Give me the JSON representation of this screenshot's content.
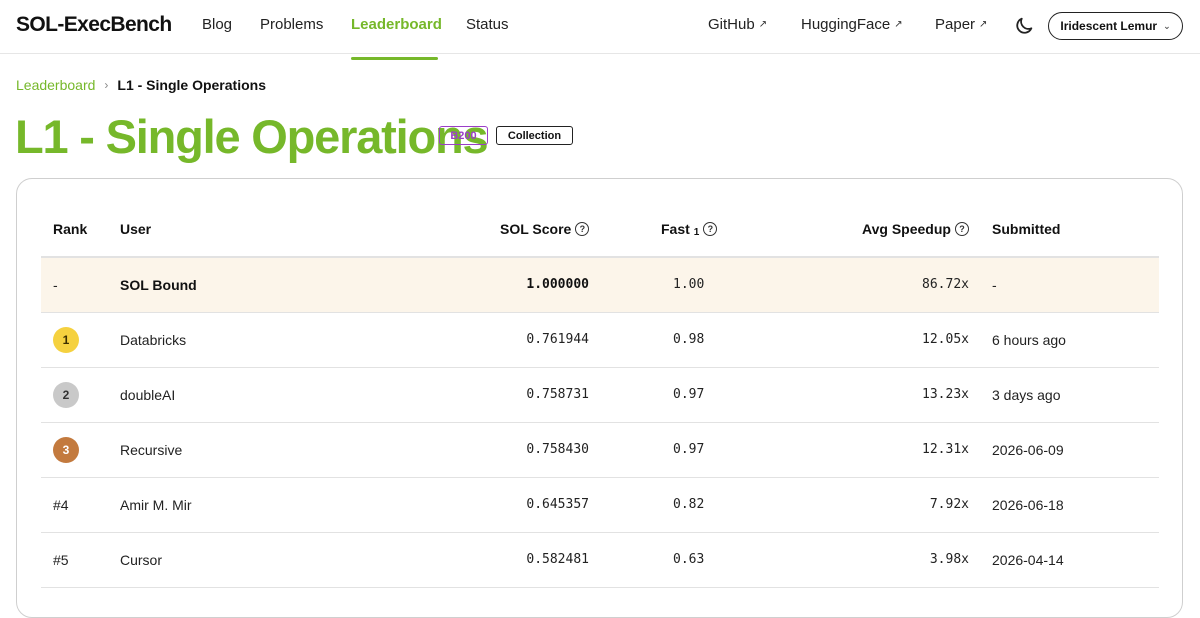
{
  "header": {
    "logo": "SOL-ExecBench",
    "nav": [
      {
        "label": "Blog"
      },
      {
        "label": "Problems"
      },
      {
        "label": "Leaderboard",
        "active": true
      },
      {
        "label": "Status"
      }
    ],
    "external_links": [
      {
        "label": "GitHub",
        "icon": "external-arrow-icon"
      },
      {
        "label": "HuggingFace",
        "icon": "external-arrow-icon"
      },
      {
        "label": "Paper",
        "icon": "external-arrow-icon"
      }
    ],
    "theme_icon": "moon-icon",
    "user_name": "Iridescent Lemur",
    "user_chevron": "⌄"
  },
  "breadcrumb": {
    "parent": "Leaderboard",
    "separator": "›",
    "current": "L1 - Single Operations"
  },
  "page": {
    "title": "L1 - Single Operations",
    "badges": {
      "gpu": "B200",
      "collection": "Collection"
    }
  },
  "colors": {
    "accent": "#76b82a",
    "gpu_badge": "#9b3ec8",
    "sol_row_bg": "#fcf5ea",
    "gold": "#f5d13f",
    "silver": "#c9c9c9",
    "bronze": "#c37a3e"
  },
  "table": {
    "columns": {
      "rank": "Rank",
      "user": "User",
      "sol_score": "SOL Score",
      "fast": "Fast",
      "fast_sub": "1",
      "avg_speedup": "Avg Speedup",
      "submitted": "Submitted"
    },
    "help_icon": "?",
    "rows": [
      {
        "rank": "-",
        "user": "SOL Bound",
        "sol_score": "1.000000",
        "fast": "1.00",
        "avg_speedup": "86.72x",
        "submitted": "-"
      },
      {
        "rank": "1",
        "medal": "gold",
        "user": "Databricks",
        "sol_score": "0.761944",
        "fast": "0.98",
        "avg_speedup": "12.05x",
        "submitted": "6 hours ago"
      },
      {
        "rank": "2",
        "medal": "silver",
        "user": "doubleAI",
        "sol_score": "0.758731",
        "fast": "0.97",
        "avg_speedup": "13.23x",
        "submitted": "3 days ago"
      },
      {
        "rank": "3",
        "medal": "bronze",
        "user": "Recursive",
        "sol_score": "0.758430",
        "fast": "0.97",
        "avg_speedup": "12.31x",
        "submitted": "2026-06-09"
      },
      {
        "rank": "#4",
        "user": "Amir M. Mir",
        "sol_score": "0.645357",
        "fast": "0.82",
        "avg_speedup": "7.92x",
        "submitted": "2026-06-18"
      },
      {
        "rank": "#5",
        "user": "Cursor",
        "sol_score": "0.582481",
        "fast": "0.63",
        "avg_speedup": "3.98x",
        "submitted": "2026-04-14"
      }
    ]
  }
}
